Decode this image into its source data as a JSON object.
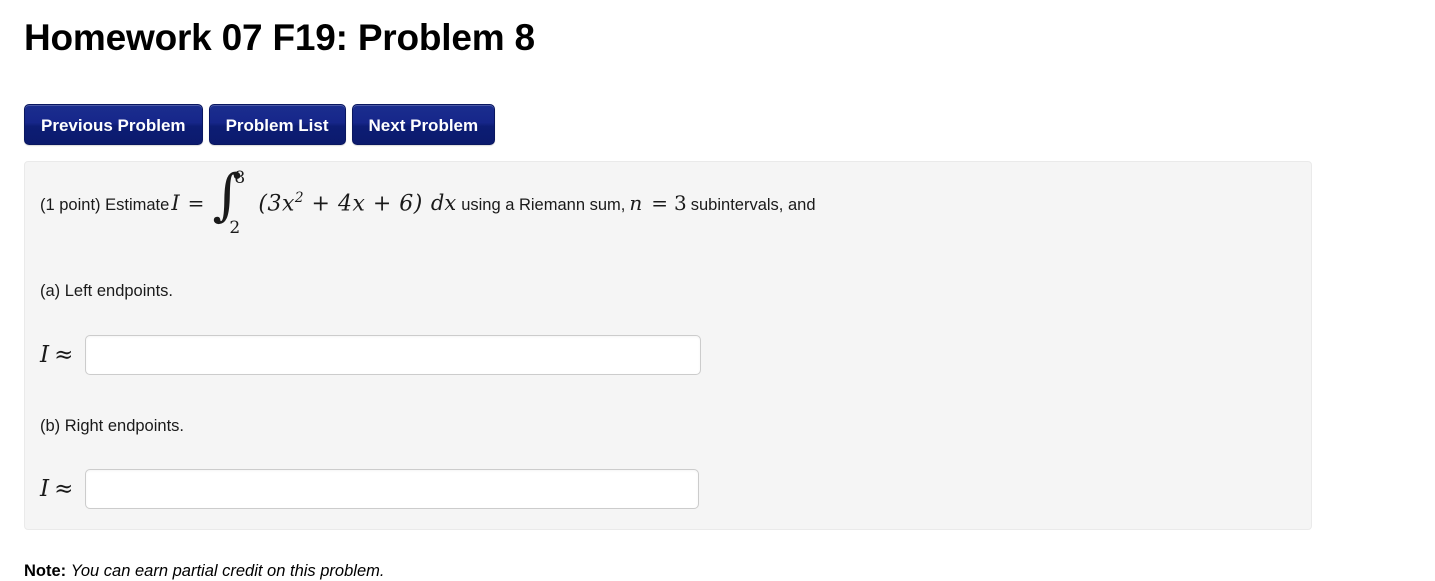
{
  "page": {
    "title": "Homework 07 F19: Problem 8"
  },
  "nav": {
    "previous_label": "Previous Problem",
    "list_label": "Problem List",
    "next_label": "Next Problem"
  },
  "problem": {
    "points_text": "(1 point) Estimate",
    "math": {
      "I": "I",
      "equals": "=",
      "integral_sign": "∫",
      "upper_limit": "8",
      "lower_limit": "2",
      "integrand_open": "(3",
      "integrand_x": "x",
      "integrand_exp": "2",
      "integrand_rest": " + 4x + 6)",
      "differential": "dx",
      "n_symbol": "n",
      "n_equals": "=",
      "n_value": "3"
    },
    "after_integral_text": "using a Riemann sum,",
    "after_n_text": "subintervals, and",
    "parts": [
      {
        "label": "(a) Left endpoints.",
        "answer_prefix_var": "I",
        "answer_prefix_sym": "≈",
        "input_value": "",
        "input_placeholder": ""
      },
      {
        "label": "(b) Right endpoints.",
        "answer_prefix_var": "I",
        "answer_prefix_sym": "≈",
        "input_value": "",
        "input_placeholder": ""
      }
    ]
  },
  "note": {
    "prefix": "Note:",
    "text": "You can earn partial credit on this problem."
  },
  "colors": {
    "button_blue": "#16268a",
    "panel_bg": "#f5f5f5",
    "panel_border": "#eaeaea",
    "input_border": "#cccccc"
  }
}
